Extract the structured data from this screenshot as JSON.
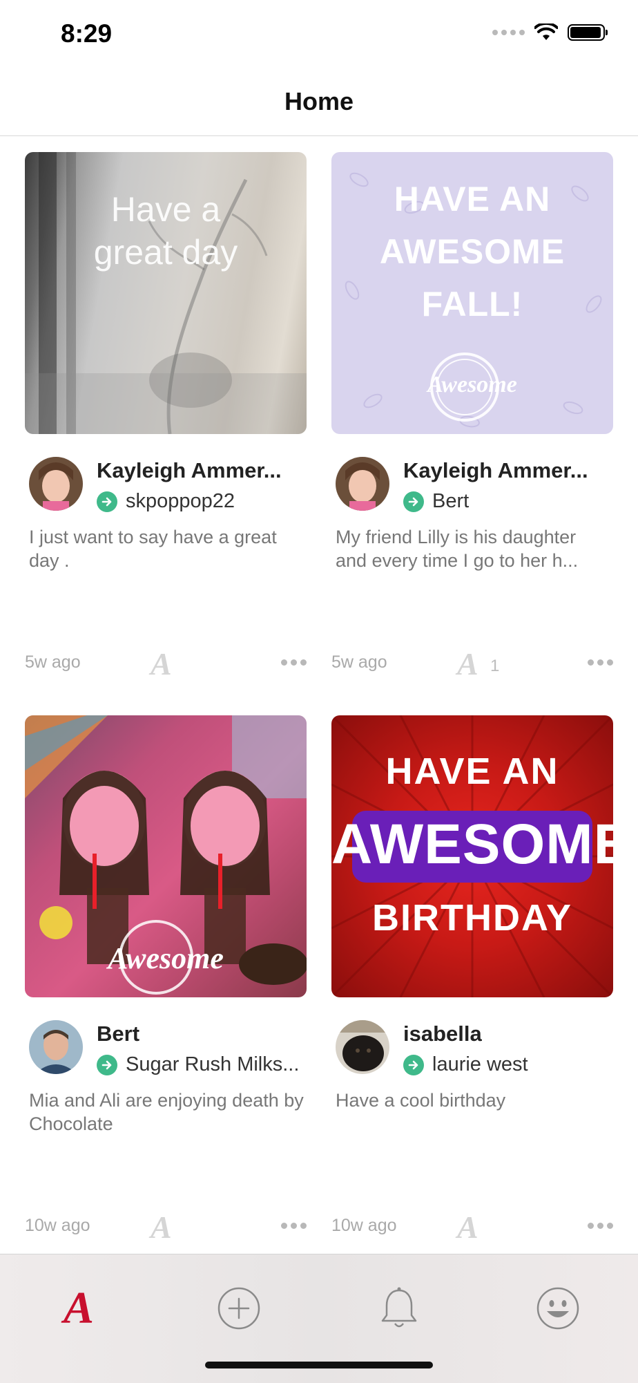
{
  "status": {
    "time": "8:29"
  },
  "nav": {
    "title": "Home"
  },
  "cards": [
    {
      "image_text": [
        "Have a",
        "great day"
      ],
      "author": "Kayleigh Ammer...",
      "recipient": "skpoppop22",
      "message": "I just want to say have a great day .",
      "time": "5w ago",
      "awesome_count": ""
    },
    {
      "image_text": [
        "HAVE AN",
        "AWESOME",
        "FALL!"
      ],
      "watermark": "Awesome",
      "author": "Kayleigh Ammer...",
      "recipient": "Bert",
      "message": "My friend Lilly is his daughter and every time I go to her h...",
      "time": "5w ago",
      "awesome_count": "1"
    },
    {
      "watermark": "Awesome",
      "author": "Bert",
      "recipient": "Sugar Rush Milks...",
      "message": "Mia and Ali are enjoying death by Chocolate",
      "time": "10w ago",
      "awesome_count": ""
    },
    {
      "image_text": [
        "HAVE AN",
        "AWESOME",
        "BIRTHDAY"
      ],
      "author": "isabella",
      "recipient": "laurie west",
      "message": "Have a cool birthday",
      "time": "10w ago",
      "awesome_count": ""
    }
  ],
  "tabs": [
    {
      "name": "home",
      "icon": "awesome-a-icon",
      "active": true
    },
    {
      "name": "create",
      "icon": "plus-circle-icon",
      "active": false
    },
    {
      "name": "notifications",
      "icon": "bell-icon",
      "active": false
    },
    {
      "name": "profile",
      "icon": "smiley-icon",
      "active": false
    }
  ],
  "colors": {
    "accent": "#c8102e",
    "badge": "#3fb98a",
    "tab_icon": "#8a8a8a"
  }
}
